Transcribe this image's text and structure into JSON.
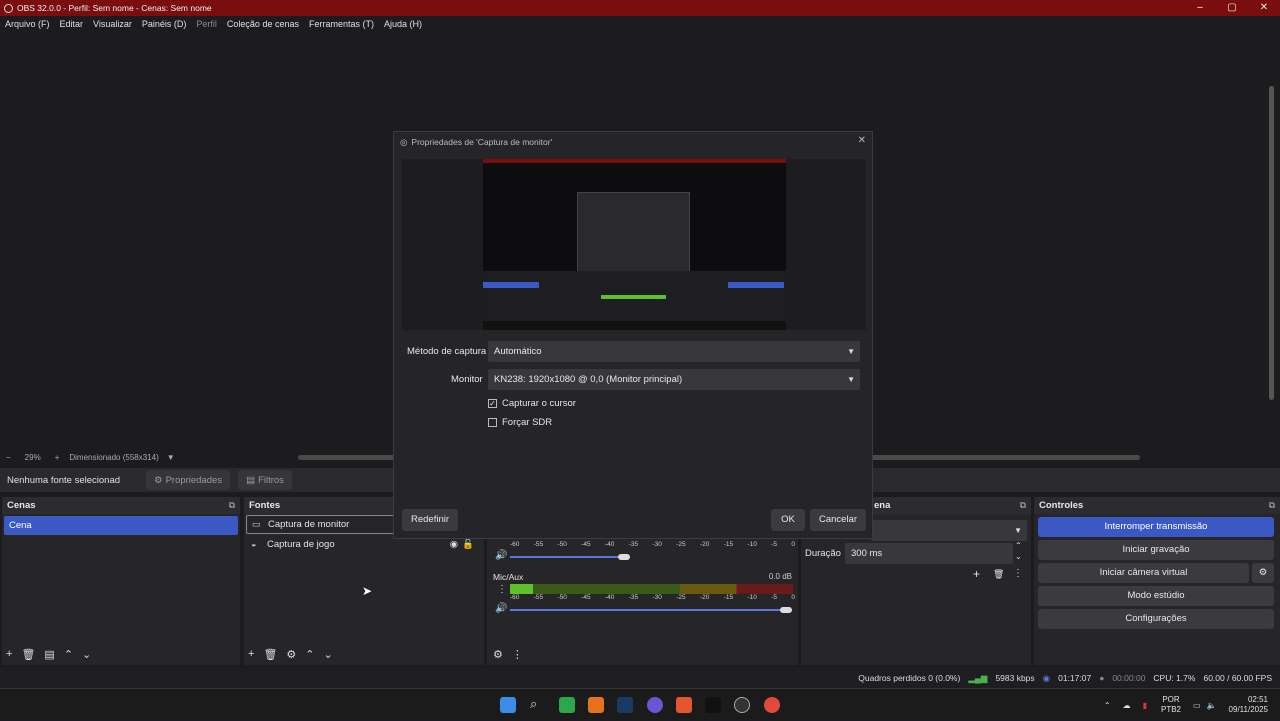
{
  "window": {
    "title": "OBS 32.0.0 - Perfil: Sem nome - Cenas: Sem nome",
    "controls": [
      "–",
      "▢",
      "✕"
    ]
  },
  "menu": [
    "Arquivo (F)",
    "Editar",
    "Visualizar",
    "Painéis (D)",
    "Perfil",
    "Coleção de cenas",
    "Ferramentas (T)",
    "Ajuda (H)"
  ],
  "zoom": {
    "minus": "−",
    "value": "29%",
    "plus": "+",
    "mode": "Dimensionado (558x314)"
  },
  "source_toolbar": {
    "no_selection": "Nenhuma fonte selecionad",
    "properties": "Propriedades",
    "filters": "Filtros"
  },
  "scenes": {
    "title": "Cenas",
    "items": [
      "Cena"
    ]
  },
  "sources": {
    "title": "Fontes",
    "items": [
      "Captura de monitor",
      "Captura de jogo"
    ]
  },
  "mixer": {
    "scale": [
      "-60",
      "-55",
      "-50",
      "-45",
      "-40",
      "-35",
      "-30",
      "-25",
      "-20",
      "-15",
      "-10",
      "-5",
      "0"
    ],
    "channel2": {
      "name": "Mic/Aux",
      "db": "0.0 dB",
      "level": 0.08
    }
  },
  "transitions": {
    "title": "ena",
    "duration_label": "Duração",
    "duration_value": "300 ms"
  },
  "controls": {
    "title": "Controles",
    "stop_stream": "Interromper transmissão",
    "start_record": "Iniciar gravação",
    "start_vcam": "Iniciar câmera virtual",
    "studio": "Modo estúdio",
    "settings": "Configurações"
  },
  "status": {
    "dropped": "Quadros perdidos 0 (0.0%)",
    "kbps": "5983 kbps",
    "stream_time": "01:17:07",
    "rec_time": "00:00:00",
    "cpu": "CPU: 1.7%",
    "fps": "60.00 / 60.00 FPS"
  },
  "dialog": {
    "title": "Propriedades de 'Captura de monitor'",
    "method_label": "Método de captura",
    "method_value": "Automático",
    "monitor_label": "Monitor",
    "monitor_value": "KN238: 1920x1080 @ 0,0 (Monitor principal)",
    "capture_cursor": "Capturar o cursor",
    "force_sdr": "Forçar SDR",
    "reset": "Redefinir",
    "ok": "OK",
    "cancel": "Cancelar"
  },
  "tray": {
    "lang1": "POR",
    "lang2": "PTB2",
    "time": "02:51",
    "date": "09/11/2025"
  },
  "colors": {
    "accent": "#3b59c5",
    "titlebar": "#7a0e0e"
  }
}
